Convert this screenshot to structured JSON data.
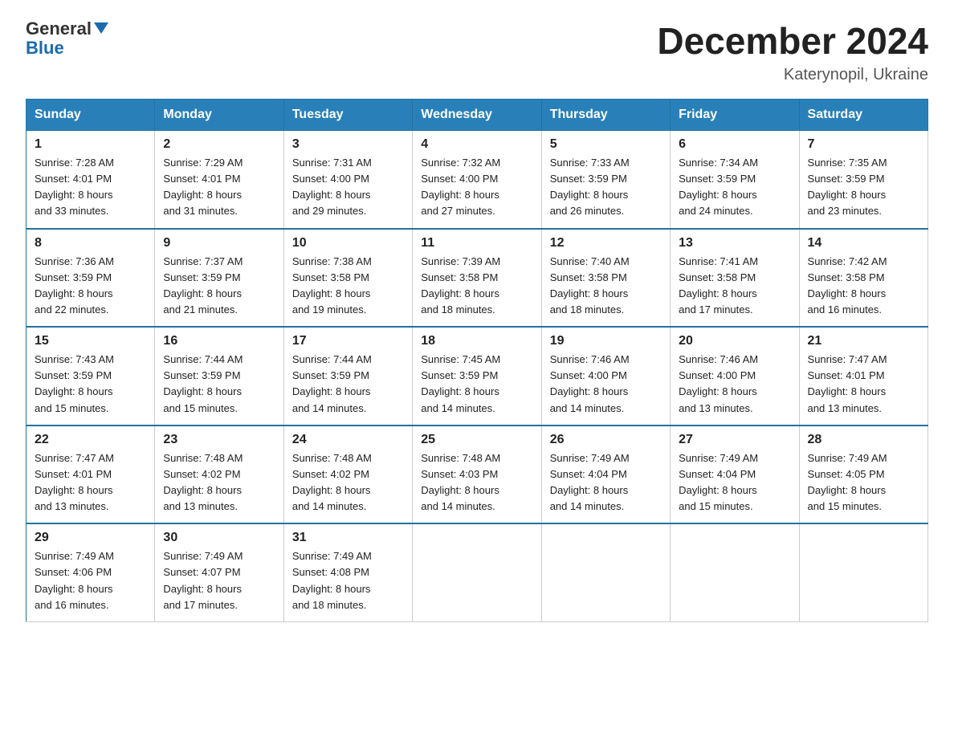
{
  "logo": {
    "general": "General",
    "blue": "Blue"
  },
  "title": "December 2024",
  "subtitle": "Katerynopil, Ukraine",
  "days_of_week": [
    "Sunday",
    "Monday",
    "Tuesday",
    "Wednesday",
    "Thursday",
    "Friday",
    "Saturday"
  ],
  "weeks": [
    [
      {
        "day": "1",
        "info": "Sunrise: 7:28 AM\nSunset: 4:01 PM\nDaylight: 8 hours\nand 33 minutes."
      },
      {
        "day": "2",
        "info": "Sunrise: 7:29 AM\nSunset: 4:01 PM\nDaylight: 8 hours\nand 31 minutes."
      },
      {
        "day": "3",
        "info": "Sunrise: 7:31 AM\nSunset: 4:00 PM\nDaylight: 8 hours\nand 29 minutes."
      },
      {
        "day": "4",
        "info": "Sunrise: 7:32 AM\nSunset: 4:00 PM\nDaylight: 8 hours\nand 27 minutes."
      },
      {
        "day": "5",
        "info": "Sunrise: 7:33 AM\nSunset: 3:59 PM\nDaylight: 8 hours\nand 26 minutes."
      },
      {
        "day": "6",
        "info": "Sunrise: 7:34 AM\nSunset: 3:59 PM\nDaylight: 8 hours\nand 24 minutes."
      },
      {
        "day": "7",
        "info": "Sunrise: 7:35 AM\nSunset: 3:59 PM\nDaylight: 8 hours\nand 23 minutes."
      }
    ],
    [
      {
        "day": "8",
        "info": "Sunrise: 7:36 AM\nSunset: 3:59 PM\nDaylight: 8 hours\nand 22 minutes."
      },
      {
        "day": "9",
        "info": "Sunrise: 7:37 AM\nSunset: 3:59 PM\nDaylight: 8 hours\nand 21 minutes."
      },
      {
        "day": "10",
        "info": "Sunrise: 7:38 AM\nSunset: 3:58 PM\nDaylight: 8 hours\nand 19 minutes."
      },
      {
        "day": "11",
        "info": "Sunrise: 7:39 AM\nSunset: 3:58 PM\nDaylight: 8 hours\nand 18 minutes."
      },
      {
        "day": "12",
        "info": "Sunrise: 7:40 AM\nSunset: 3:58 PM\nDaylight: 8 hours\nand 18 minutes."
      },
      {
        "day": "13",
        "info": "Sunrise: 7:41 AM\nSunset: 3:58 PM\nDaylight: 8 hours\nand 17 minutes."
      },
      {
        "day": "14",
        "info": "Sunrise: 7:42 AM\nSunset: 3:58 PM\nDaylight: 8 hours\nand 16 minutes."
      }
    ],
    [
      {
        "day": "15",
        "info": "Sunrise: 7:43 AM\nSunset: 3:59 PM\nDaylight: 8 hours\nand 15 minutes."
      },
      {
        "day": "16",
        "info": "Sunrise: 7:44 AM\nSunset: 3:59 PM\nDaylight: 8 hours\nand 15 minutes."
      },
      {
        "day": "17",
        "info": "Sunrise: 7:44 AM\nSunset: 3:59 PM\nDaylight: 8 hours\nand 14 minutes."
      },
      {
        "day": "18",
        "info": "Sunrise: 7:45 AM\nSunset: 3:59 PM\nDaylight: 8 hours\nand 14 minutes."
      },
      {
        "day": "19",
        "info": "Sunrise: 7:46 AM\nSunset: 4:00 PM\nDaylight: 8 hours\nand 14 minutes."
      },
      {
        "day": "20",
        "info": "Sunrise: 7:46 AM\nSunset: 4:00 PM\nDaylight: 8 hours\nand 13 minutes."
      },
      {
        "day": "21",
        "info": "Sunrise: 7:47 AM\nSunset: 4:01 PM\nDaylight: 8 hours\nand 13 minutes."
      }
    ],
    [
      {
        "day": "22",
        "info": "Sunrise: 7:47 AM\nSunset: 4:01 PM\nDaylight: 8 hours\nand 13 minutes."
      },
      {
        "day": "23",
        "info": "Sunrise: 7:48 AM\nSunset: 4:02 PM\nDaylight: 8 hours\nand 13 minutes."
      },
      {
        "day": "24",
        "info": "Sunrise: 7:48 AM\nSunset: 4:02 PM\nDaylight: 8 hours\nand 14 minutes."
      },
      {
        "day": "25",
        "info": "Sunrise: 7:48 AM\nSunset: 4:03 PM\nDaylight: 8 hours\nand 14 minutes."
      },
      {
        "day": "26",
        "info": "Sunrise: 7:49 AM\nSunset: 4:04 PM\nDaylight: 8 hours\nand 14 minutes."
      },
      {
        "day": "27",
        "info": "Sunrise: 7:49 AM\nSunset: 4:04 PM\nDaylight: 8 hours\nand 15 minutes."
      },
      {
        "day": "28",
        "info": "Sunrise: 7:49 AM\nSunset: 4:05 PM\nDaylight: 8 hours\nand 15 minutes."
      }
    ],
    [
      {
        "day": "29",
        "info": "Sunrise: 7:49 AM\nSunset: 4:06 PM\nDaylight: 8 hours\nand 16 minutes."
      },
      {
        "day": "30",
        "info": "Sunrise: 7:49 AM\nSunset: 4:07 PM\nDaylight: 8 hours\nand 17 minutes."
      },
      {
        "day": "31",
        "info": "Sunrise: 7:49 AM\nSunset: 4:08 PM\nDaylight: 8 hours\nand 18 minutes."
      },
      null,
      null,
      null,
      null
    ]
  ]
}
